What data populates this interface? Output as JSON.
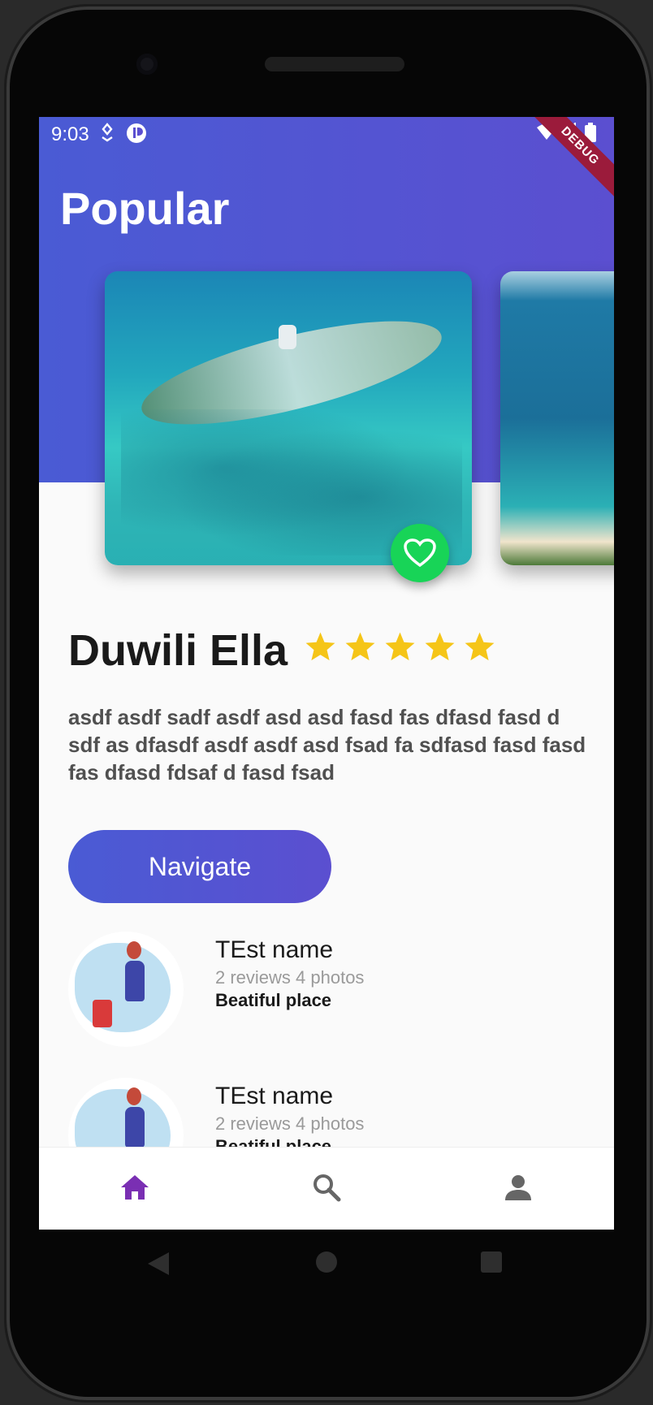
{
  "status_bar": {
    "time": "9:03",
    "debug_banner": "DEBUG"
  },
  "header": {
    "title": "Popular"
  },
  "place": {
    "name": "Duwili Ella",
    "rating": 5,
    "rating_max": 5,
    "description": "asdf asdf sadf asdf asd asd fasd fas dfasd fasd d sdf as dfasdf asdf asdf asd fsad fa sdfasd fasd fasd fas dfasd fdsaf d fasd fsad"
  },
  "actions": {
    "navigate_label": "Navigate"
  },
  "reviews": [
    {
      "name": "TEst name",
      "meta": "2 reviews 4 photos",
      "comment": "Beatiful place"
    },
    {
      "name": "TEst name",
      "meta": "2 reviews 4 photos",
      "comment": "Beatiful place"
    }
  ],
  "bottom_nav": [
    {
      "icon": "home-icon",
      "active": true
    },
    {
      "icon": "search-icon",
      "active": false
    },
    {
      "icon": "person-icon",
      "active": false
    }
  ],
  "colors": {
    "accent": "#4a5bd4",
    "active_nav": "#7a2fb3",
    "star": "#f5c518",
    "favorite": "#18d457"
  }
}
